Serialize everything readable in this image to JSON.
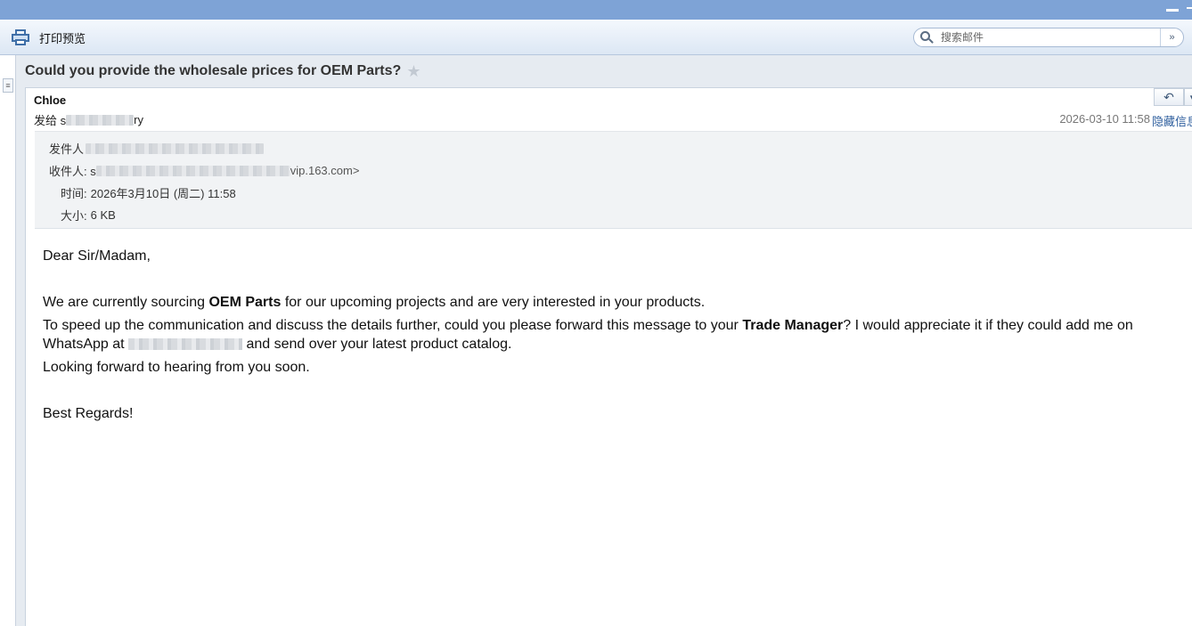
{
  "toolbar": {
    "print_label": "打印预览",
    "search_placeholder": "搜索邮件",
    "search_value": "",
    "dropdown_glyph": "»"
  },
  "mail": {
    "subject": "Could you provide the wholesale prices for OEM Parts?",
    "sender_name": "Chloe",
    "to_prefix": "发给 s",
    "to_suffix": "ry",
    "date": "2026-03-10 11:58",
    "hide_info": "隐藏信息",
    "details": {
      "from_label": "发件人",
      "to_label": "收件人: s",
      "to_suffix": "vip.163.com>",
      "time_label": "时间:",
      "time_value": "2026年3月10日 (周二) 11:58",
      "size_label": "大小:",
      "size_value": "6 KB"
    },
    "body": {
      "greeting": "Dear Sir/Madam,",
      "p1_a": "We are currently sourcing ",
      "p1_bold": "OEM Parts",
      "p1_b": " for our upcoming projects and are very interested in your products.",
      "p2_a": "To speed up the communication and discuss the details further, could you please forward this message to your ",
      "p2_bold": "Trade Manager",
      "p2_b": "? I would appreciate it if they could add me on WhatsApp at ",
      "p2_c": " and send over your latest product catalog.",
      "p3": "Looking forward to hearing from you soon.",
      "closing": "Best Regards!"
    }
  },
  "icons": {
    "print": "printer-icon",
    "search": "search-icon",
    "star": "star-icon",
    "reply": "reply-icon"
  },
  "colors": {
    "titlebar": "#7ea3d6",
    "link": "#2f5f9e",
    "header_bg": "#e6ebf1"
  }
}
